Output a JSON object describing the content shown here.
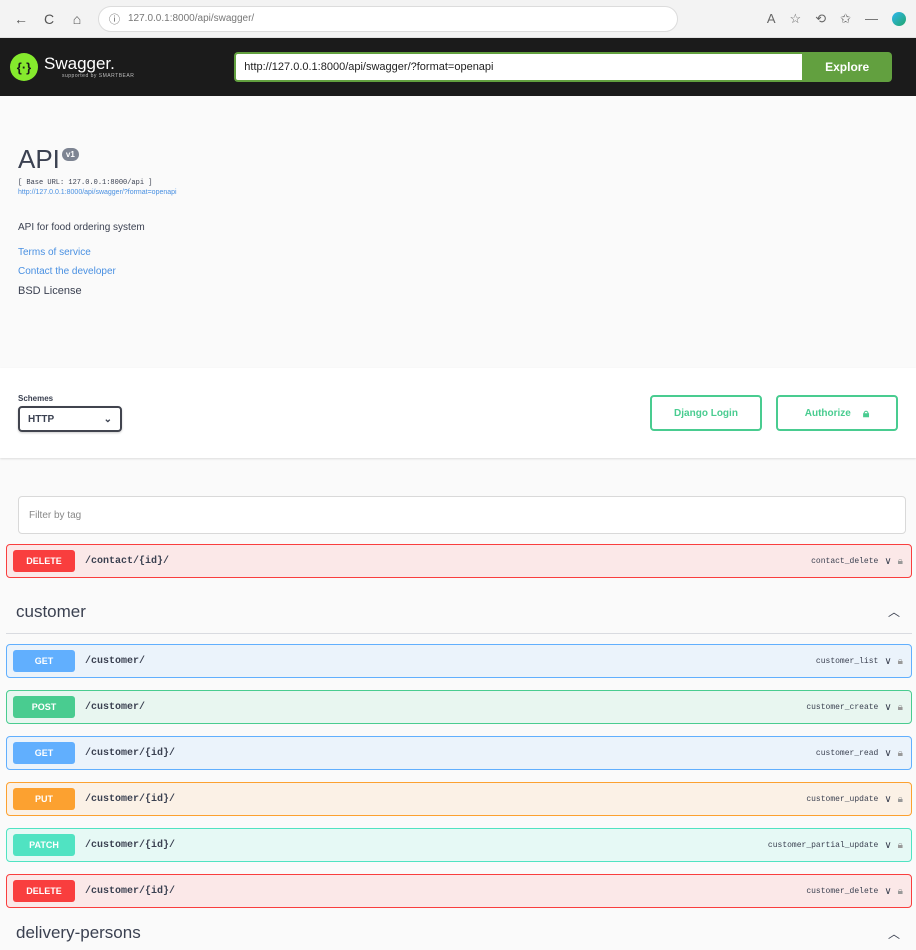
{
  "browser": {
    "url": "127.0.0.1:8000/api/swagger/",
    "back": "←",
    "reload": "C",
    "home": "⌂",
    "info": "ⓘ"
  },
  "topbar": {
    "brand": "Swagger.",
    "brand_sub": "supported by SMARTBEAR",
    "spec_url": "http://127.0.0.1:8000/api/swagger/?format=openapi",
    "explore": "Explore"
  },
  "info": {
    "title": "API",
    "version": "v1",
    "base_url": "[ Base URL: 127.0.0.1:8000/api ]",
    "spec_link": "http://127.0.0.1:8000/api/swagger/?format=openapi",
    "description": "API for food ordering system",
    "terms": "Terms of service",
    "contact": "Contact the developer",
    "license": "BSD License"
  },
  "schemes": {
    "label": "Schemes",
    "selected": "HTTP",
    "django_login": "Django Login",
    "authorize": "Authorize"
  },
  "filter": {
    "placeholder": "Filter by tag"
  },
  "ops_top": [
    {
      "method": "DELETE",
      "path": "/contact/{id}/",
      "summary": "contact_delete",
      "kind": "delete"
    }
  ],
  "tags": [
    {
      "name": "customer",
      "ops": [
        {
          "method": "GET",
          "path": "/customer/",
          "summary": "customer_list",
          "kind": "get"
        },
        {
          "method": "POST",
          "path": "/customer/",
          "summary": "customer_create",
          "kind": "post"
        },
        {
          "method": "GET",
          "path": "/customer/{id}/",
          "summary": "customer_read",
          "kind": "get"
        },
        {
          "method": "PUT",
          "path": "/customer/{id}/",
          "summary": "customer_update",
          "kind": "put"
        },
        {
          "method": "PATCH",
          "path": "/customer/{id}/",
          "summary": "customer_partial_update",
          "kind": "patch"
        },
        {
          "method": "DELETE",
          "path": "/customer/{id}/",
          "summary": "customer_delete",
          "kind": "delete"
        }
      ]
    },
    {
      "name": "delivery-persons",
      "ops": []
    }
  ],
  "colors": {
    "delete": "#f93e3e",
    "get": "#61affe",
    "post": "#49cc90",
    "put": "#fca130",
    "patch": "#50e3c2",
    "explore": "#62a03f"
  }
}
